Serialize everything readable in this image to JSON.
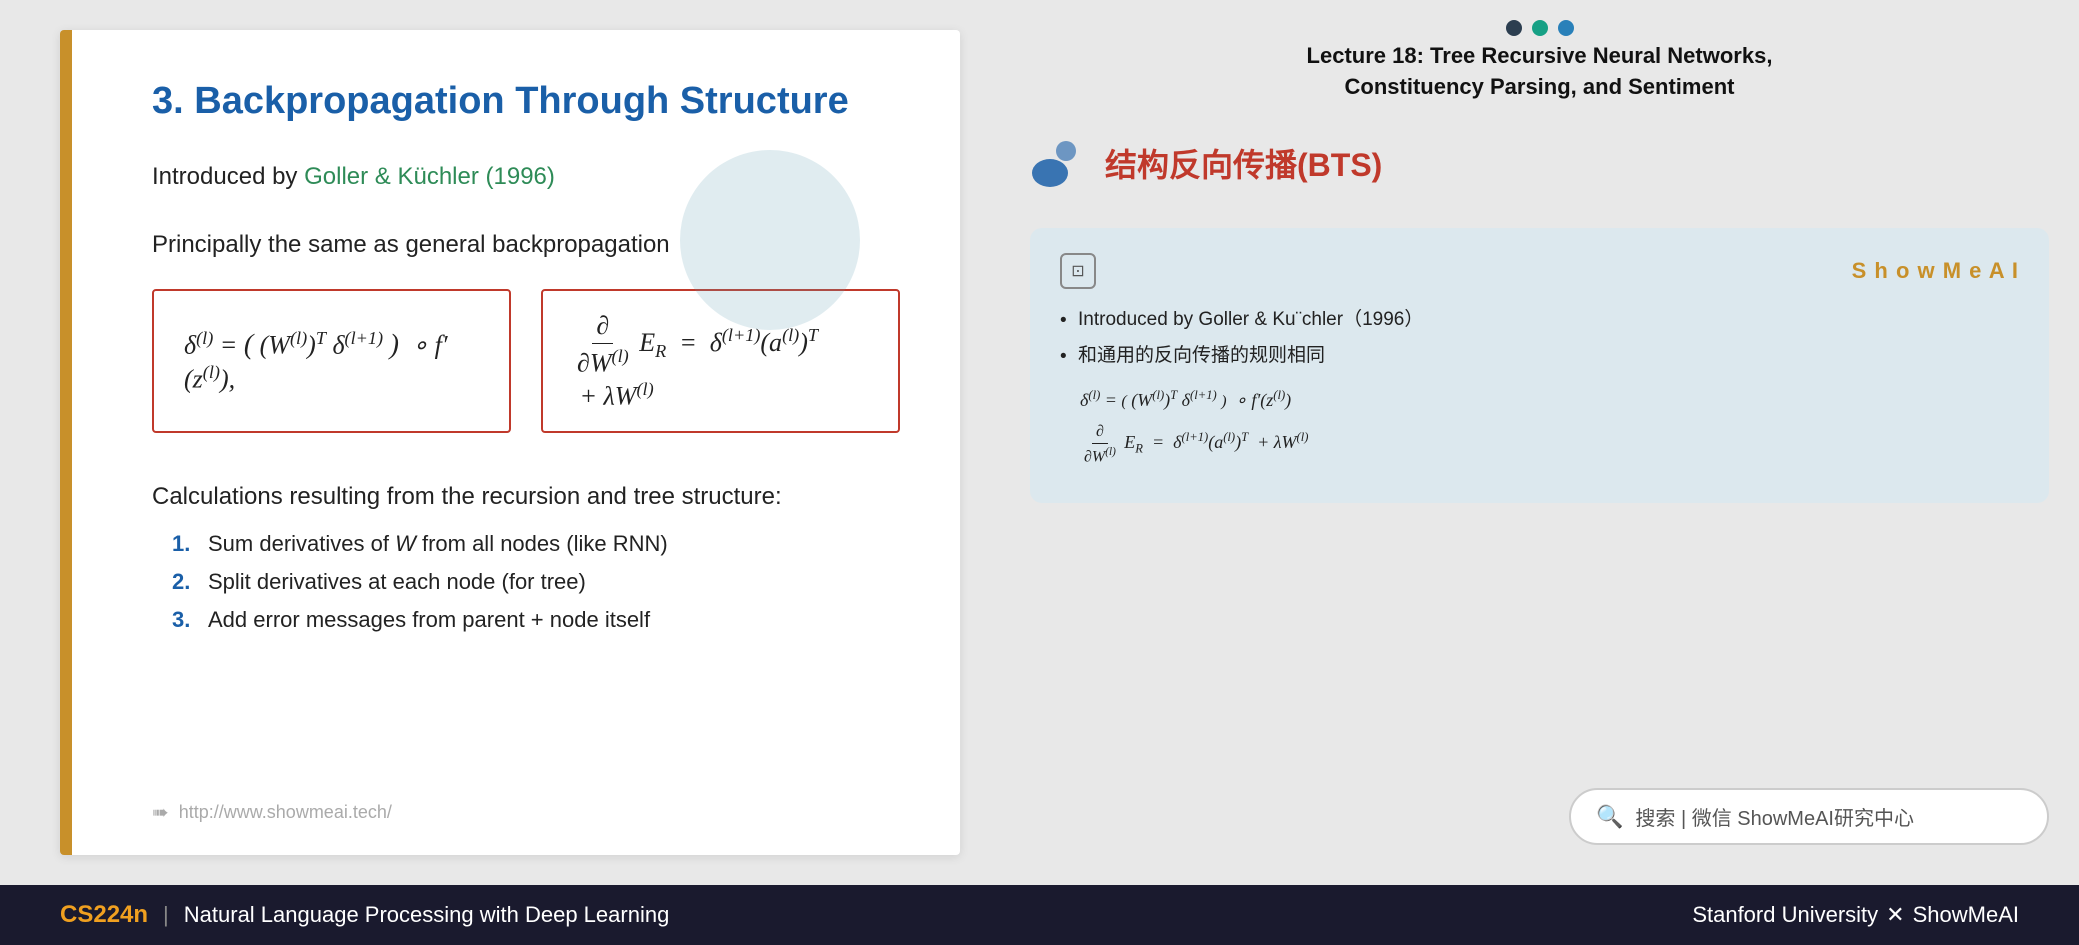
{
  "lecture": {
    "title_line1": "Lecture 18: Tree Recursive Neural Networks,",
    "title_line2": "Constituency Parsing, and Sentiment"
  },
  "slide": {
    "title": "3. Backpropagation Through Structure",
    "intro": "Introduced by Goller & Küchler (1996)",
    "intro_highlight": "Goller & Küchler (1996)",
    "principle": "Principally the same as general backpropagation",
    "formula1": "δ⁽ˡ⁾ = ((W⁽ˡ⁾)ᵀ δ⁽ˡ⁺¹⁾) ∘ f′(z⁽ˡ⁾),",
    "formula2": "∂/∂W⁽ˡ⁾ E_R = δ⁽ˡ⁺¹⁾(a⁽ˡ⁾)ᵀ + λW⁽ˡ⁾",
    "calculations": "Calculations resulting from the recursion and tree structure:",
    "list": [
      {
        "num": "1.",
        "text": "Sum derivatives of W from all nodes (like RNN)"
      },
      {
        "num": "2.",
        "text": "Split derivatives at each node (for tree)"
      },
      {
        "num": "3.",
        "text": "Add error messages from parent + node itself"
      }
    ],
    "url": "http://www.showmeai.tech/"
  },
  "right_panel": {
    "heading_chinese": "结构反向传播(BTS)",
    "showmeai_label": "S h o w M e A I",
    "card": {
      "bullet1": "Introduced by Goller & Ku¨chler（1996）",
      "bullet2": "和通用的反向传播的规则相同",
      "formula1": "δ⁽ˡ⁾ = (（W⁽ˡ⁾)ᵀ δ⁽ˡ⁺¹⁾) ∘ f′(z⁽ˡ⁾)",
      "formula2": "∂/∂W⁽ˡ⁾ E_R = δ⁽ˡ⁺¹⁾(a⁽ˡ⁾)ᵀ + λW⁽ˡ⁾"
    }
  },
  "search": {
    "placeholder": "搜索 | 微信 ShowMeAI研究中心"
  },
  "footer": {
    "course_code": "CS224n",
    "divider": "|",
    "course_name": "Natural Language Processing with Deep Learning",
    "university": "Stanford University",
    "x": "✕",
    "brand": "ShowMeAI"
  },
  "dots": [
    {
      "color": "#2c3e50"
    },
    {
      "color": "#16a085"
    },
    {
      "color": "#2980b9"
    }
  ]
}
